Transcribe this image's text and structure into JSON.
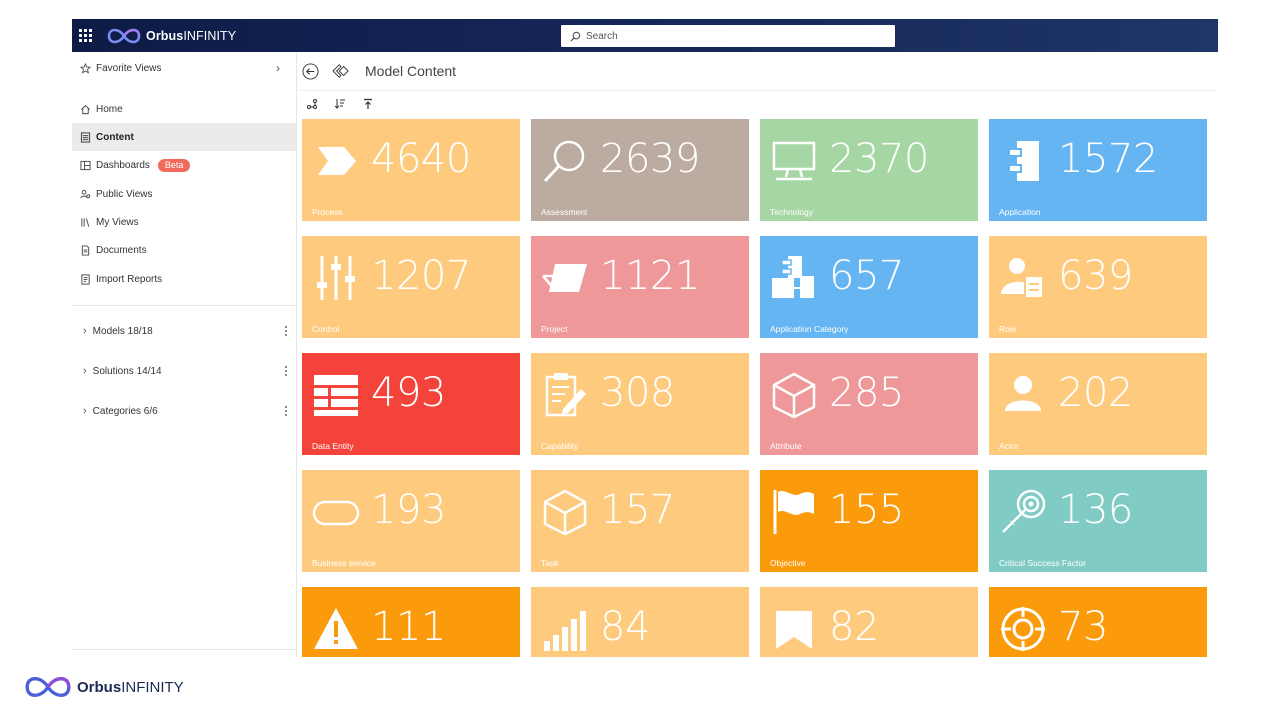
{
  "header": {
    "brand_bold": "Orbus",
    "brand_light": "INFINITY",
    "search_placeholder": "Search"
  },
  "sidebar": {
    "favorite_views": "Favorite Views",
    "items": [
      {
        "label": "Home",
        "icon": "home-icon"
      },
      {
        "label": "Content",
        "icon": "content-icon"
      },
      {
        "label": "Dashboards",
        "icon": "dashboards-icon",
        "badge": "Beta"
      },
      {
        "label": "Public Views",
        "icon": "public-views-icon"
      },
      {
        "label": "My Views",
        "icon": "my-views-icon"
      },
      {
        "label": "Documents",
        "icon": "documents-icon"
      },
      {
        "label": "Import Reports",
        "icon": "import-reports-icon"
      }
    ],
    "groups": [
      {
        "label": "Models 18/18"
      },
      {
        "label": "Solutions 14/14"
      },
      {
        "label": "Categories 6/6"
      }
    ]
  },
  "main": {
    "title": "Model Content",
    "tiles": [
      {
        "count": "4640",
        "label": "Process",
        "color": "#fecb7e",
        "icon": "chevron-process-icon"
      },
      {
        "count": "2639",
        "label": "Assessment",
        "color": "#bcaba1",
        "icon": "magnifier-icon"
      },
      {
        "count": "2370",
        "label": "Technology",
        "color": "#a6d6a3",
        "icon": "computer-icon"
      },
      {
        "count": "1572",
        "label": "Application",
        "color": "#64b5f2",
        "icon": "application-component-icon"
      },
      {
        "count": "1207",
        "label": "Control",
        "color": "#fecb7e",
        "icon": "sliders-icon"
      },
      {
        "count": "1121",
        "label": "Project",
        "color": "#ee9899",
        "icon": "project-icon"
      },
      {
        "count": "657",
        "label": "Application Category",
        "color": "#64b5f2",
        "icon": "app-category-icon"
      },
      {
        "count": "639",
        "label": "Role",
        "color": "#fecb7e",
        "icon": "role-icon"
      },
      {
        "count": "493",
        "label": "Data Entity",
        "color": "#f4433b",
        "icon": "data-entity-icon"
      },
      {
        "count": "308",
        "label": "Capability",
        "color": "#fecb7e",
        "icon": "clipboard-edit-icon"
      },
      {
        "count": "285",
        "label": "Attribute",
        "color": "#ee9899",
        "icon": "cube-icon"
      },
      {
        "count": "202",
        "label": "Actor",
        "color": "#fecb7e",
        "icon": "person-icon"
      },
      {
        "count": "193",
        "label": "Business service",
        "color": "#fecb7e",
        "icon": "rounded-rect-icon"
      },
      {
        "count": "157",
        "label": "Task",
        "color": "#fecb7e",
        "icon": "box-icon"
      },
      {
        "count": "155",
        "label": "Objective",
        "color": "#fb9a0a",
        "icon": "flag-icon"
      },
      {
        "count": "136",
        "label": "Critical Success Factor",
        "color": "#80cbc4",
        "icon": "target-arrow-icon"
      },
      {
        "count": "111",
        "label": "",
        "color": "#fb9a0a",
        "icon": "warning-icon"
      },
      {
        "count": "84",
        "label": "",
        "color": "#fecb7e",
        "icon": "bar-signal-icon"
      },
      {
        "count": "82",
        "label": "",
        "color": "#fecb7e",
        "icon": "banner-icon"
      },
      {
        "count": "73",
        "label": "",
        "color": "#fb9a0a",
        "icon": "crosshair-icon"
      }
    ]
  },
  "footer": {
    "brand_bold": "Orbus",
    "brand_light": "INFINITY"
  }
}
